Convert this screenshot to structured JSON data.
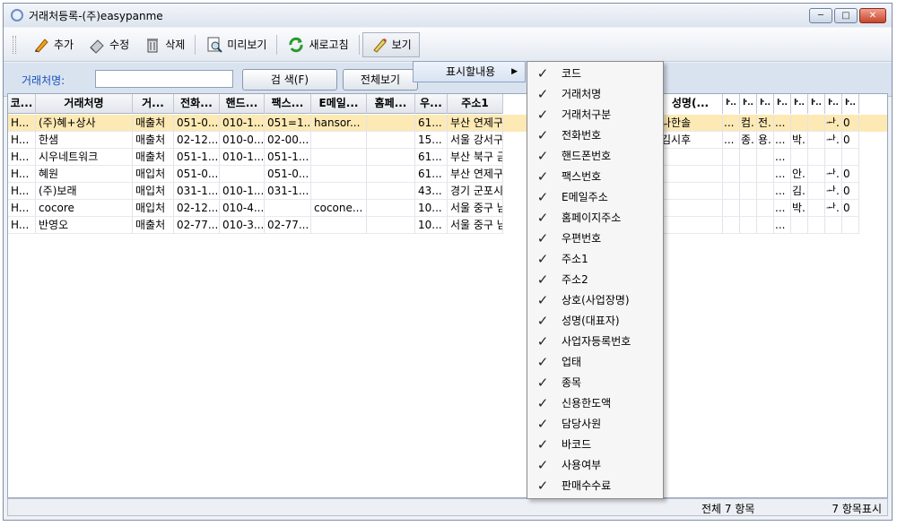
{
  "window": {
    "title": "거래처등록-(주)easypanme",
    "btn_min": "─",
    "btn_max": "□",
    "btn_close": "✕"
  },
  "toolbar": {
    "add": "추가",
    "edit": "수정",
    "delete": "삭제",
    "preview": "미리보기",
    "refresh": "새로고침",
    "view": "보기"
  },
  "search": {
    "label": "거래처명:",
    "value": "",
    "search_btn": "검 색(F)",
    "all_btn": "전체보기"
  },
  "grid": {
    "columns": [
      "코...",
      "거래처명",
      "거...",
      "전화...",
      "핸드...",
      "팩스...",
      "E메일...",
      "홈페...",
      "우...",
      "주소1"
    ],
    "right_columns": [
      "성명(...",
      "ŀ..",
      "ŀ..",
      "ŀ..",
      "ŀ..",
      "ŀ..",
      "ŀ..",
      "ŀ..",
      "ŀ.."
    ],
    "rows": [
      [
        "H...",
        "(주)혜+상사",
        "매출처",
        "051-0...",
        "010-1...",
        "051=1...",
        "hansor...",
        "",
        "61...",
        "부산 연제구"
      ],
      [
        "H...",
        "한샘",
        "매출처",
        "02-12...",
        "010-0...",
        "02-00...",
        "",
        "",
        "15...",
        "서울 강서구"
      ],
      [
        "H...",
        "시우네트워크",
        "매출처",
        "051-1...",
        "010-1...",
        "051-1...",
        "",
        "",
        "61...",
        "부산 북구 금"
      ],
      [
        "H...",
        "혜원",
        "매입처",
        "051-0...",
        "",
        "051-0...",
        "",
        "",
        "61...",
        "부산 연제구"
      ],
      [
        "H...",
        "(주)보래",
        "매입처",
        "031-1...",
        "010-1...",
        "031-1...",
        "",
        "",
        "43...",
        "경기 군포시"
      ],
      [
        "H...",
        "cocore",
        "매입처",
        "02-12...",
        "010-4...",
        "",
        "cocone...",
        "",
        "10...",
        "서울 중구 남"
      ],
      [
        "H...",
        "반영오",
        "매출처",
        "02-77...",
        "010-3...",
        "02-77...",
        "",
        "",
        "10...",
        "서울 중구 남"
      ]
    ],
    "right_rows": [
      [
        "나한솔",
        "...",
        "컴.",
        "전.",
        "...",
        "",
        "",
        "ᅪ.",
        "0"
      ],
      [
        "김시후",
        "...",
        "종.",
        "용.",
        "...",
        "박.",
        "",
        "ᅪ.",
        "0"
      ],
      [
        "",
        "",
        "",
        "",
        "...",
        "",
        "",
        "",
        ""
      ],
      [
        "",
        "",
        "",
        "",
        "...",
        "안.",
        "",
        "ᅪ.",
        "0"
      ],
      [
        "",
        "",
        "",
        "",
        "...",
        "김.",
        "",
        "ᅪ.",
        "0"
      ],
      [
        "",
        "",
        "",
        "",
        "...",
        "박.",
        "",
        "ᅪ.",
        "0"
      ],
      [
        "",
        "",
        "",
        "",
        "...",
        "",
        "",
        "",
        ""
      ]
    ]
  },
  "footer": {
    "total": "전체 7 항목",
    "shown": "7 항목표시"
  },
  "submenu": {
    "label": "표시할내용",
    "arrow": "▶"
  },
  "popup": {
    "check": "✓",
    "items": [
      "코드",
      "거래처명",
      "거래처구분",
      "전화번호",
      "핸드폰번호",
      "팩스번호",
      "E메일주소",
      "홈페이지주소",
      "우편번호",
      "주소1",
      "주소2",
      "상호(사업장명)",
      "성명(대표자)",
      "사업자등록번호",
      "업태",
      "종목",
      "신용한도액",
      "담당사원",
      "바코드",
      "사용여부",
      "판매수수료"
    ]
  }
}
